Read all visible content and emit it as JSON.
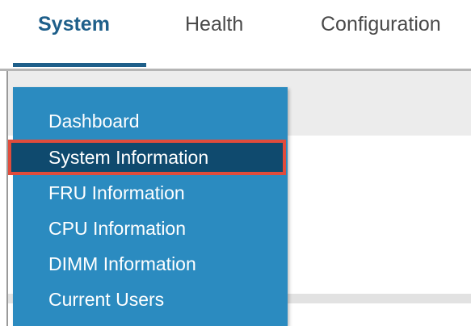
{
  "tabs": {
    "system": "System",
    "health": "Health",
    "configuration": "Configuration"
  },
  "menu": {
    "items": [
      "Dashboard",
      "System Information",
      "FRU Information",
      "CPU Information",
      "DIMM Information",
      "Current Users"
    ],
    "selected": "System Information"
  },
  "colors": {
    "accent": "#1e5f8a",
    "menu_bg": "#2b8bc0",
    "menu_selected_bg": "#0f4a6e",
    "highlight_border": "#e04c3c"
  }
}
